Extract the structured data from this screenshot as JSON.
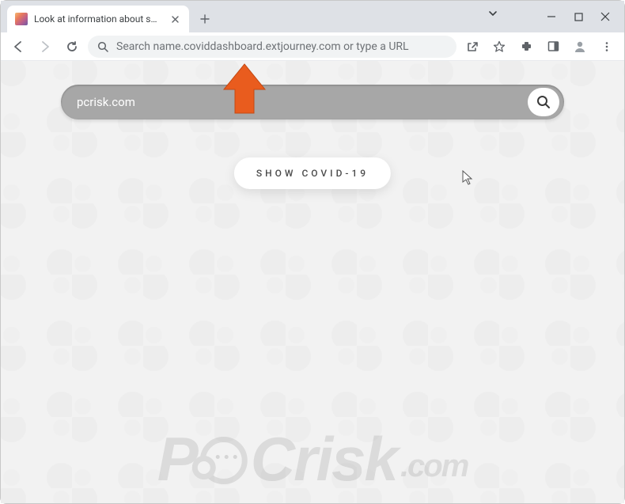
{
  "tab": {
    "title": "Look at information about spread"
  },
  "omnibox": {
    "placeholder": "Search name.coviddashboard.extjourney.com or type a URL"
  },
  "page": {
    "search_value": "pcrisk.com",
    "show_button": "SHOW COVID-19"
  },
  "watermark": {
    "p": "P",
    "c": "C",
    "risk": "risk",
    "com": ".com"
  }
}
